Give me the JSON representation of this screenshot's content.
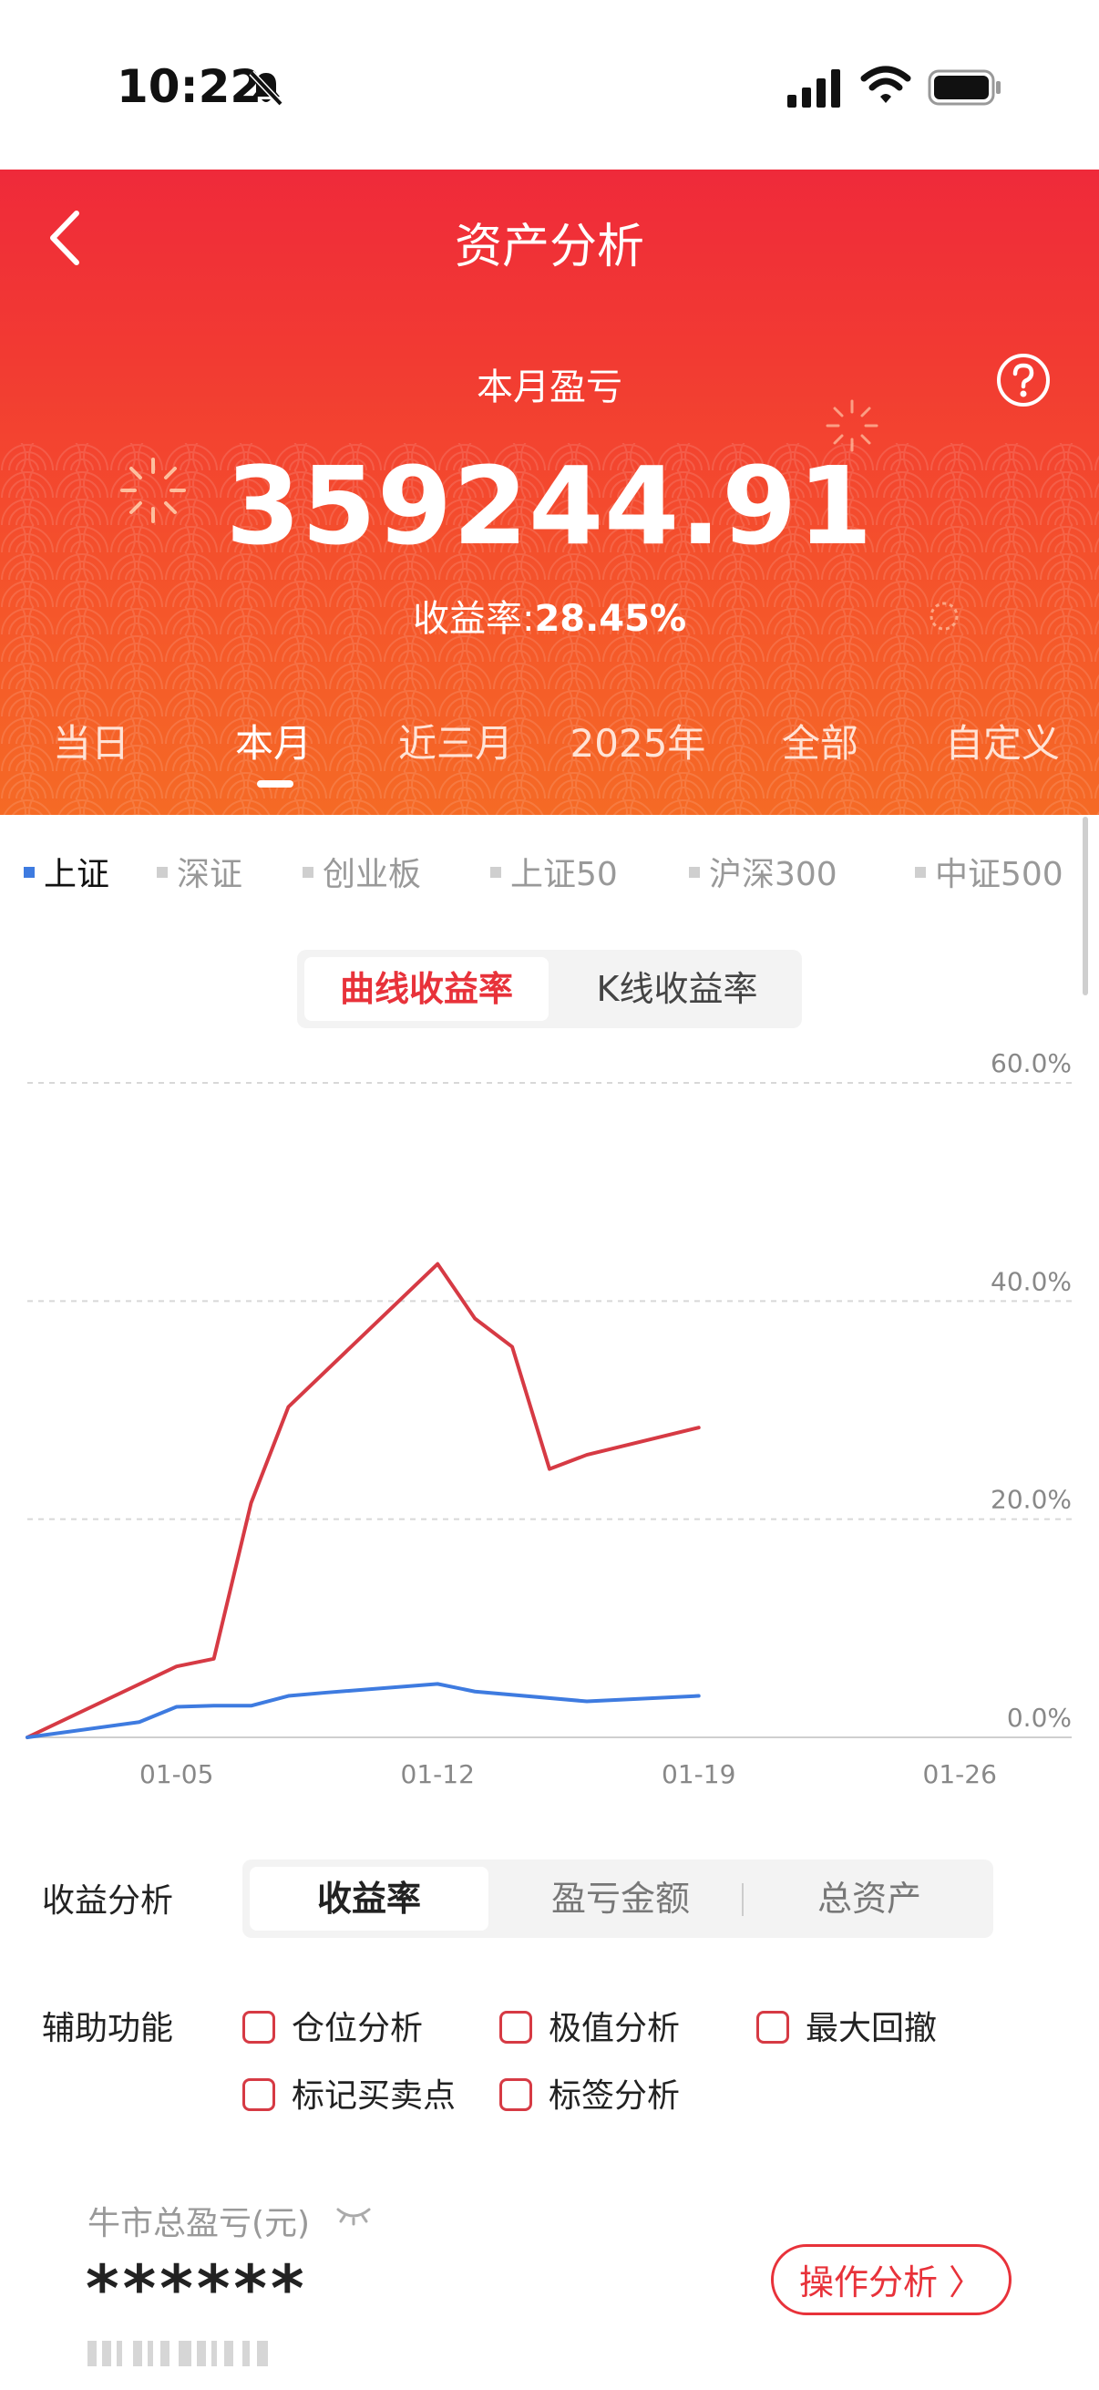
{
  "status_bar": {
    "time": "10:22"
  },
  "header": {
    "title": "资产分析",
    "month_label": "本月盈亏",
    "profit": "359244.91",
    "yield_label": "收益率:",
    "yield_value": "28.45%",
    "tabs": [
      "当日",
      "本月",
      "近三月",
      "2025年",
      "全部",
      "自定义"
    ],
    "active_tab": "本月"
  },
  "indices": {
    "items": [
      "上证",
      "深证",
      "创业板",
      "上证50",
      "沪深300",
      "中证500"
    ],
    "active": "上证"
  },
  "chart_toggle": {
    "curve": "曲线收益率",
    "kline": "K线收益率"
  },
  "chart_data": {
    "type": "line",
    "x_ticks": [
      "01-05",
      "01-12",
      "01-19",
      "01-26"
    ],
    "y_ticks": [
      "0.0%",
      "20.0%",
      "40.0%",
      "60.0%"
    ],
    "ylim": [
      0,
      60
    ],
    "grid": true,
    "series": [
      {
        "color": "#d63a44",
        "x": [
          "01-01",
          "01-05",
          "01-06",
          "01-07",
          "01-08",
          "01-12",
          "01-13",
          "01-14",
          "01-15",
          "01-16",
          "01-19"
        ],
        "values": [
          0,
          6.5,
          7.2,
          21.5,
          30.3,
          43.4,
          38.4,
          35.8,
          24.6,
          25.9,
          28.4
        ]
      },
      {
        "color": "#3e7be0",
        "x": [
          "01-01",
          "01-04",
          "01-05",
          "01-06",
          "01-07",
          "01-08",
          "01-09",
          "01-12",
          "01-13",
          "01-16",
          "01-19"
        ],
        "values": [
          0,
          1.4,
          2.8,
          2.9,
          2.9,
          3.8,
          4.1,
          4.9,
          4.2,
          3.3,
          3.8
        ]
      }
    ]
  },
  "analysis": {
    "label": "收益分析",
    "options": [
      "收益率",
      "盈亏金额",
      "总资产"
    ],
    "active": "收益率"
  },
  "aux": {
    "label": "辅助功能",
    "options": [
      "仓位分析",
      "极值分析",
      "最大回撤",
      "标记买卖点",
      "标签分析"
    ]
  },
  "bull": {
    "label": "牛市总盈亏(元)",
    "value": "******",
    "button": "操作分析 〉"
  },
  "colors": {
    "header_red": "#ef2a3a",
    "header_orange": "#f56a25",
    "accent_red": "#e8323a",
    "index_blue": "#3e7be0"
  }
}
